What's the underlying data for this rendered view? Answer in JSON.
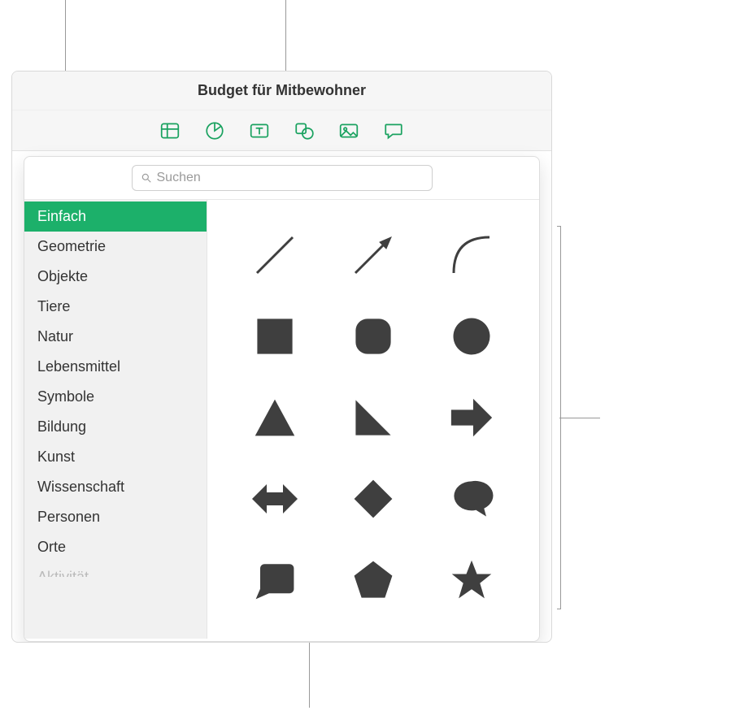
{
  "header": {
    "title": "Budget für Mitbewohner"
  },
  "toolbar": {
    "items": [
      {
        "name": "table-icon"
      },
      {
        "name": "chart-icon"
      },
      {
        "name": "textbox-icon"
      },
      {
        "name": "shape-icon"
      },
      {
        "name": "media-icon"
      },
      {
        "name": "comment-icon"
      }
    ]
  },
  "search": {
    "placeholder": "Suchen"
  },
  "sidebar": {
    "items": [
      {
        "label": "Einfach",
        "selected": true
      },
      {
        "label": "Geometrie"
      },
      {
        "label": "Objekte"
      },
      {
        "label": "Tiere"
      },
      {
        "label": "Natur"
      },
      {
        "label": "Lebensmittel"
      },
      {
        "label": "Symbole"
      },
      {
        "label": "Bildung"
      },
      {
        "label": "Kunst"
      },
      {
        "label": "Wissenschaft"
      },
      {
        "label": "Personen"
      },
      {
        "label": "Orte"
      },
      {
        "label": "Aktivität"
      }
    ]
  },
  "shapes": [
    {
      "name": "line"
    },
    {
      "name": "arrow-line"
    },
    {
      "name": "curve"
    },
    {
      "name": "square"
    },
    {
      "name": "rounded-square"
    },
    {
      "name": "circle"
    },
    {
      "name": "triangle"
    },
    {
      "name": "right-triangle"
    },
    {
      "name": "arrow-right"
    },
    {
      "name": "arrow-leftright"
    },
    {
      "name": "diamond"
    },
    {
      "name": "speech-bubble"
    },
    {
      "name": "callout-rect"
    },
    {
      "name": "pentagon"
    },
    {
      "name": "star"
    }
  ],
  "colors": {
    "accent": "#1cb06a",
    "shape": "#3f3f3f"
  }
}
